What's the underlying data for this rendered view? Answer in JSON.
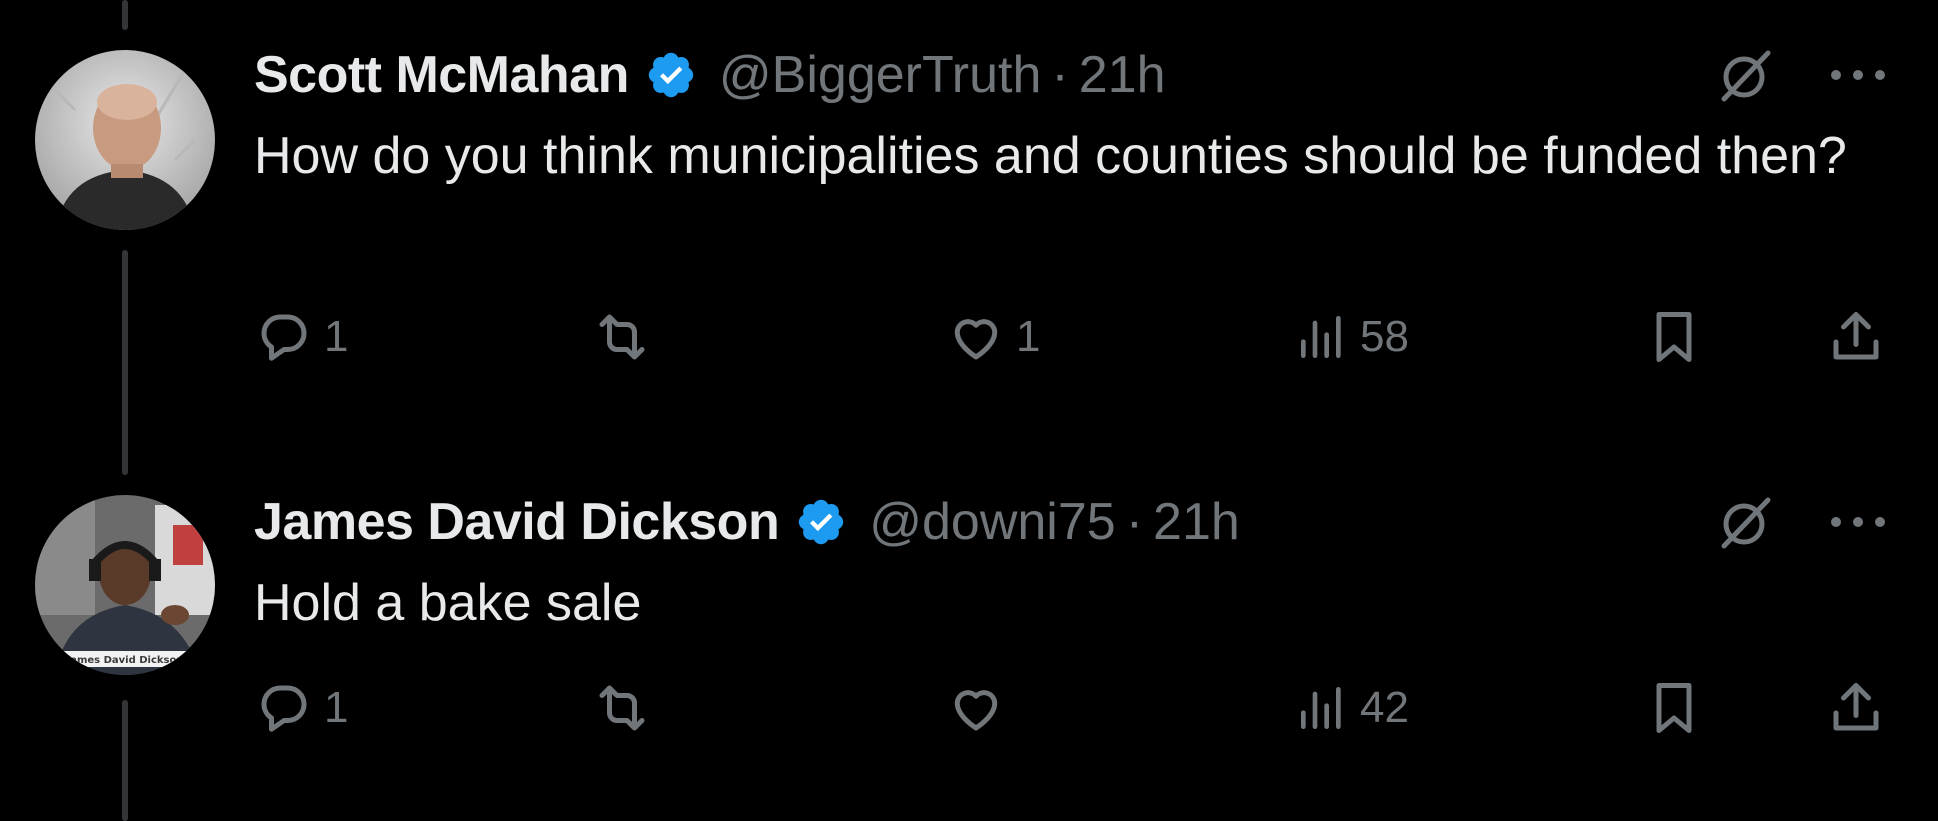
{
  "posts": [
    {
      "display_name": "Scott McMahan",
      "handle": "@BiggerTruth",
      "separator": "·",
      "time": "21h",
      "text": "How do you think municipalities and counties should be funded then?",
      "reply_count": "1",
      "retweet_count": "",
      "like_count": "1",
      "view_count": "58",
      "verified": true
    },
    {
      "display_name": "James David Dickson",
      "handle": "@downi75",
      "separator": "·",
      "time": "21h",
      "text": "Hold a bake sale",
      "reply_count": "1",
      "retweet_count": "",
      "like_count": "",
      "view_count": "42",
      "verified": true,
      "avatar_caption": "James David Dickson"
    }
  ],
  "icons": {
    "verified": "verified-badge-icon",
    "grok": "grok-icon",
    "more": "more-icon",
    "reply": "reply-icon",
    "retweet": "retweet-icon",
    "like": "like-icon",
    "views": "views-icon",
    "bookmark": "bookmark-icon",
    "share": "share-icon"
  },
  "colors": {
    "background": "#000000",
    "primary_text": "#e7e9ea",
    "secondary_text": "#71767b",
    "verified_blue": "#1d9bf0",
    "thread_line": "#333639"
  }
}
